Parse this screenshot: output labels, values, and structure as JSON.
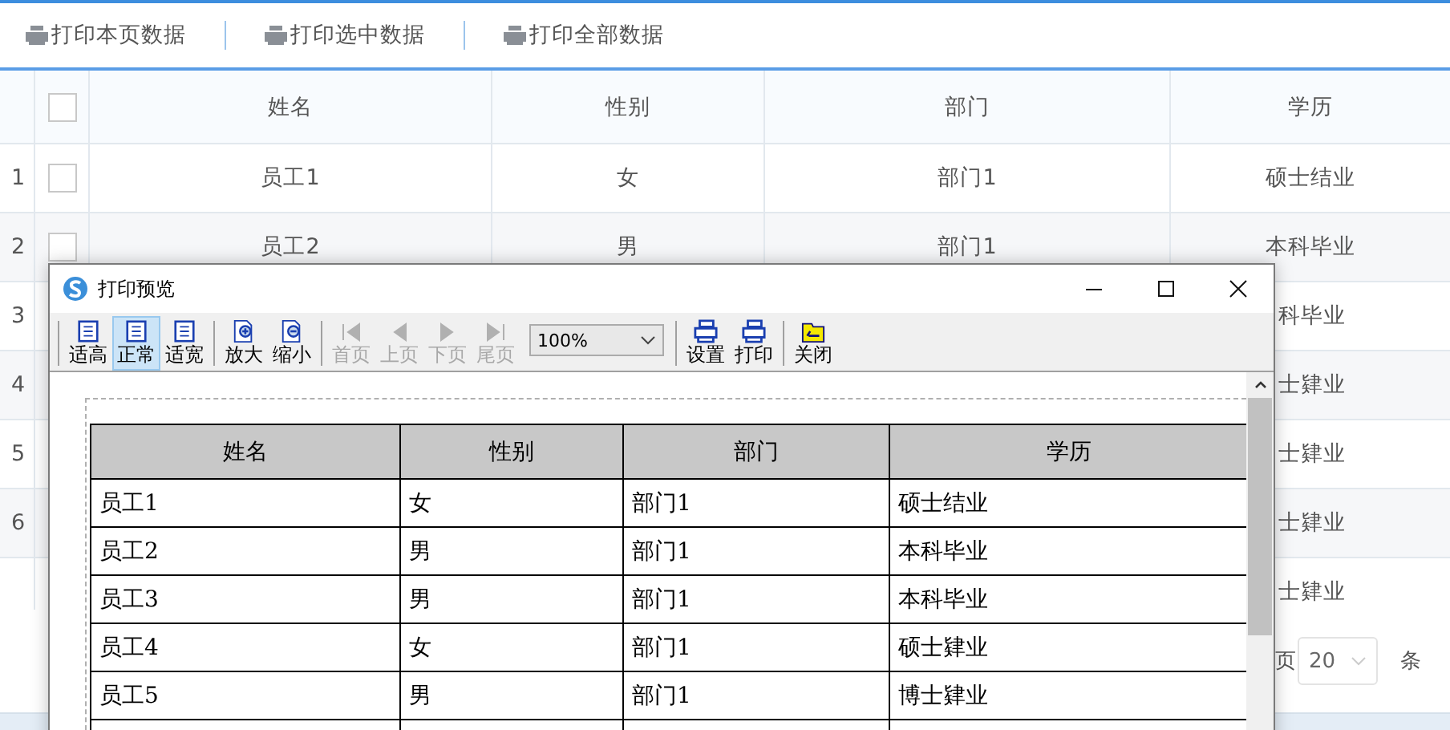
{
  "toolbar": {
    "buttons": [
      {
        "label": "打印本页数据"
      },
      {
        "label": "打印选中数据"
      },
      {
        "label": "打印全部数据"
      }
    ]
  },
  "grid": {
    "columns": [
      "姓名",
      "性别",
      "部门",
      "学历"
    ],
    "header_checked": false,
    "rows": [
      {
        "number": "1",
        "covered": false,
        "checked": false,
        "cells": [
          "员工1",
          "女",
          "部门1",
          "硕士结业"
        ]
      },
      {
        "number": "2",
        "covered": false,
        "checked": false,
        "cells": [
          "员工2",
          "男",
          "部门1",
          "本科毕业"
        ]
      },
      {
        "number": "3",
        "covered": true,
        "cells": [
          "科毕业"
        ]
      },
      {
        "number": "4",
        "covered": true,
        "cells": [
          "士肄业"
        ]
      },
      {
        "number": "5",
        "covered": true,
        "cells": [
          "士肄业"
        ]
      },
      {
        "number": "6",
        "covered": true,
        "cells": [
          "士肄业"
        ]
      },
      {
        "covered": true,
        "cells": [
          "士肄业"
        ]
      }
    ]
  },
  "pager": {
    "page_label": "页",
    "page_size": "20",
    "unit": "条"
  },
  "dialog": {
    "title": "打印预览",
    "toolbar_groups": [
      [
        {
          "label": "适高",
          "selected": false,
          "disabled": false
        },
        {
          "label": "正常",
          "selected": true,
          "disabled": false
        },
        {
          "label": "适宽",
          "selected": false,
          "disabled": false
        }
      ],
      [
        {
          "label": "放大",
          "selected": false,
          "disabled": false
        },
        {
          "label": "缩小",
          "selected": false,
          "disabled": false
        }
      ],
      [
        {
          "label": "首页",
          "selected": false,
          "disabled": true
        },
        {
          "label": "上页",
          "selected": false,
          "disabled": true
        },
        {
          "label": "下页",
          "selected": false,
          "disabled": true
        },
        {
          "label": "尾页",
          "selected": false,
          "disabled": true
        }
      ],
      [
        {
          "label": "设置",
          "selected": false,
          "disabled": false
        },
        {
          "label": "打印",
          "selected": false,
          "disabled": false
        }
      ],
      [
        {
          "label": "关闭",
          "selected": false,
          "disabled": false
        }
      ]
    ],
    "zoom": "100%",
    "table": {
      "columns": [
        "姓名",
        "性别",
        "部门",
        "学历"
      ],
      "rows": [
        [
          "员工1",
          "女",
          "部门1",
          "硕士结业"
        ],
        [
          "员工2",
          "男",
          "部门1",
          "本科毕业"
        ],
        [
          "员工3",
          "男",
          "部门1",
          "本科毕业"
        ],
        [
          "员工4",
          "女",
          "部门1",
          "硕士肄业"
        ],
        [
          "员工5",
          "男",
          "部门1",
          "博士肄业"
        ]
      ]
    }
  }
}
